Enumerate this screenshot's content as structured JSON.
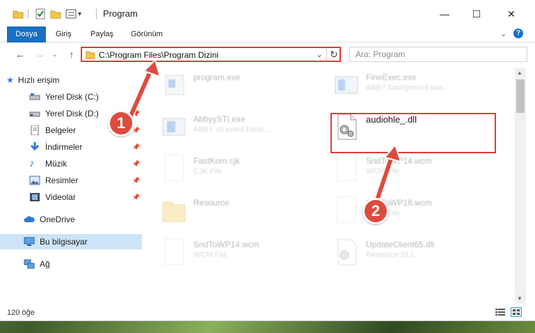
{
  "window": {
    "title": "Program",
    "controls": {
      "minimize": "—",
      "maximize": "☐",
      "close": "✕"
    }
  },
  "ribbon": {
    "tabs": [
      "Dosya",
      "Giriş",
      "Paylaş",
      "Görünüm"
    ],
    "expand_icon": "chevron-down-icon",
    "help_icon": "?"
  },
  "nav": {
    "back_icon": "←",
    "forward_icon": "→",
    "recent_icon": "⌄",
    "up_icon": "↑"
  },
  "address": {
    "path": "C:\\Program Files\\Program Dizini",
    "dropdown_icon": "⌄",
    "refresh_icon": "↻"
  },
  "search": {
    "placeholder": "Ara: Program"
  },
  "sidebar": {
    "quick_access": "Hızlı erişim",
    "items": [
      {
        "label": "Yerel Disk (C:)",
        "icon": "drive-icon",
        "pinned": false
      },
      {
        "label": "Yerel Disk (D:)",
        "icon": "drive-icon",
        "pinned": true
      },
      {
        "label": "Belgeler",
        "icon": "documents-icon",
        "pinned": true
      },
      {
        "label": "İndirmeler",
        "icon": "downloads-icon",
        "pinned": true
      },
      {
        "label": "Müzik",
        "icon": "music-icon",
        "pinned": true
      },
      {
        "label": "Resimler",
        "icon": "pictures-icon",
        "pinned": true
      },
      {
        "label": "Videolar",
        "icon": "videos-icon",
        "pinned": true
      }
    ],
    "onedrive": "OneDrive",
    "this_pc": "Bu bilgisayar",
    "network": "Ağ"
  },
  "files": [
    {
      "name": "program.exe",
      "sub": ""
    },
    {
      "name": "FineExec.exe",
      "sub": "ABBY background exe..."
    },
    {
      "name": "AbbyySTI.exe",
      "sub": "ABBY sti event hand..."
    },
    {
      "name": "audiohle_.dll",
      "sub": ""
    },
    {
      "name": "FastKorn.cjk",
      "sub": "CJK File"
    },
    {
      "name": "SndToWP14.wcm",
      "sub": "WCM File"
    },
    {
      "name": "Resource",
      "sub": ""
    },
    {
      "name": "SndToWP16.wcm",
      "sub": "WCM File"
    },
    {
      "name": "SndToWP14.wcm",
      "sub": "WCM File"
    },
    {
      "name": "UpdateClient65.dll",
      "sub": "Resource DLL"
    }
  ],
  "status": {
    "count": "120 öğe"
  },
  "annotations": {
    "step1": "1",
    "step2": "2",
    "highlight_color": "#e03a3a",
    "badge_color": "#dd4b3e"
  }
}
